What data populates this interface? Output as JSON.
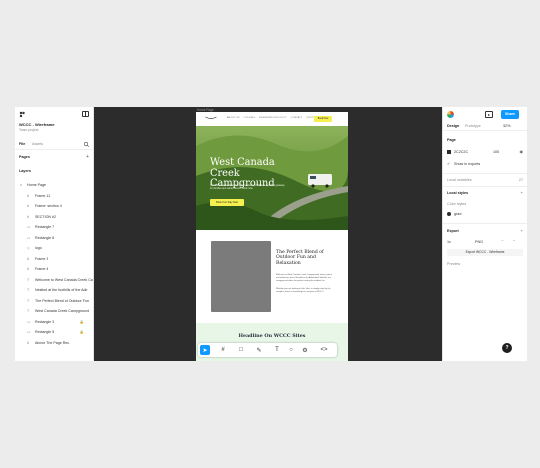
{
  "left_panel": {
    "file_title": "WCCC - Wireframe",
    "file_subtitle": "Team project",
    "tab_file": "File",
    "tab_assets": "Assets",
    "pages_heading": "Pages",
    "layers_heading": "Layers",
    "layers": [
      {
        "icon": "⌂",
        "label": "Home Page",
        "lock": false,
        "home": true
      },
      {
        "icon": "#",
        "label": "Frame 11",
        "lock": false
      },
      {
        "icon": "#",
        "label": "Frame: section 4",
        "lock": false
      },
      {
        "icon": "#",
        "label": "SECTION #2",
        "lock": false
      },
      {
        "icon": "▭",
        "label": "Rectangle 7",
        "lock": false
      },
      {
        "icon": "▭",
        "label": "Rectangle 8",
        "lock": false
      },
      {
        "icon": "◇",
        "label": "logo",
        "lock": false
      },
      {
        "icon": "#",
        "label": "Frame 3",
        "lock": false
      },
      {
        "icon": "#",
        "label": "Frame 4",
        "lock": false
      },
      {
        "icon": "T",
        "label": "Welcome to West Canada Creek Ca",
        "lock": false
      },
      {
        "icon": "T",
        "label": "Nestled at the foothills of the Adir",
        "lock": false
      },
      {
        "icon": "T",
        "label": "The Perfect Blend of Outdoor Fun",
        "lock": false
      },
      {
        "icon": "T",
        "label": "West Canada Creek Campground",
        "lock": false
      },
      {
        "icon": "▭",
        "label": "Rectangle 3",
        "lock": true
      },
      {
        "icon": "▭",
        "label": "Rectangle 5",
        "lock": true
      },
      {
        "icon": "#",
        "label": "Above The Page Rec.",
        "lock": false
      }
    ]
  },
  "canvas": {
    "frame_label": "Home Page",
    "nav_links": [
      "ABOUT US",
      "LODGING",
      "RESERVATION POLICY",
      "CONTACT",
      "PHOTOS"
    ],
    "nav_cta": "Book Now",
    "hero_title": "West Canada Creek Campground",
    "hero_text": "Nestled at the foothills of the Adirondacks, WCCC is a perfect getaway for families and nature lovers. Book now.",
    "hero_button": "Book Your Stay Now",
    "section2_title": "The Perfect Blend of Outdoor Fun and Relaxation",
    "section2_p1": "Welcome to West Canada Creek Campground, where nature and adventure meet. Nestled in the Adirondack foothills, our campground offers the perfect setting for outdoor fun.",
    "section2_p2": "Whether you are looking to fish, hike, or simply relax by the campfire, there is something for everyone at WCCC.",
    "band_heading": "Headline On WCCC Sites"
  },
  "right_panel": {
    "share_label": "Share",
    "tab_design": "Design",
    "tab_prototype": "Prototype",
    "zoom": "32%",
    "page_heading": "Page",
    "page_color": "2C2C2C",
    "page_opacity": "100",
    "show_in_exports": "Show in exports",
    "local_variables": "Local variables",
    "variables_count": "27",
    "local_styles": "Local styles",
    "color_styles": "Color styles",
    "color_style_name": "grad",
    "export_heading": "Export",
    "export_scale": "1x",
    "export_format": "PNG",
    "export_button": "Export WCCC - Wireframe",
    "preview_label": "Preview"
  },
  "toolbar": {
    "tools": [
      "move",
      "frame",
      "rectangle",
      "pen",
      "text",
      "comment",
      "actions",
      "dev-mode"
    ]
  },
  "help_label": "?"
}
